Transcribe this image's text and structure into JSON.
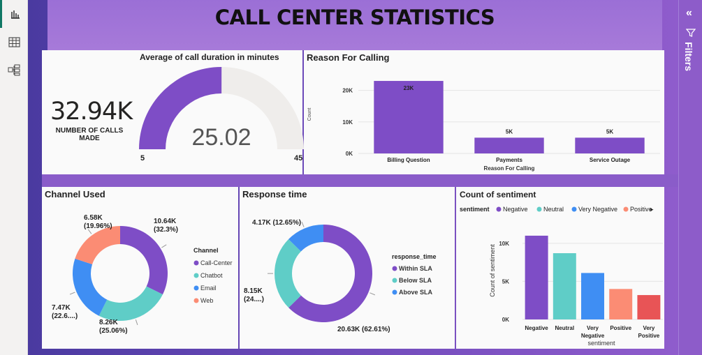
{
  "page_title": "CALL CENTER STATISTICS",
  "filters_label": "Filters",
  "kpi": {
    "value": "32.94K",
    "label_line1": "NUMBER OF CALLS",
    "label_line2": "MADE"
  },
  "gauge": {
    "title": "Average of call duration in minutes",
    "value": 25.02,
    "value_label": "25.02",
    "min": 5,
    "max": 45,
    "min_label": "5",
    "max_label": "45",
    "fill_color": "#7e4dc6",
    "track_color": "#efedeb"
  },
  "chart_data": [
    {
      "type": "bar",
      "title": "Reason For Calling",
      "xlabel": "Reason For Calling",
      "ylabel": "Count",
      "categories": [
        "Billing Question",
        "Payments",
        "Service Outage"
      ],
      "values": [
        23000,
        5000,
        5000
      ],
      "data_labels": [
        "23K",
        "5K",
        "5K"
      ],
      "ylim": [
        0,
        25000
      ],
      "yticks": [
        0,
        10000,
        20000
      ],
      "ytick_labels": [
        "0K",
        "10K",
        "20K"
      ],
      "color": "#7e4dc6"
    },
    {
      "type": "pie",
      "title": "Channel Used",
      "legend_title": "Channel",
      "categories": [
        "Call-Center",
        "Chatbot",
        "Email",
        "Web"
      ],
      "values": [
        10640,
        8260,
        7470,
        6580
      ],
      "data_labels": [
        [
          "10.64K",
          "(32.3%)"
        ],
        [
          "8.26K",
          "(25.06%)"
        ],
        [
          "7.47K",
          "(22.6....)"
        ],
        [
          "6.58K",
          "(19.96%)"
        ]
      ],
      "colors": [
        "#7e4dc6",
        "#5fcdc7",
        "#3f8ef3",
        "#fb8c74"
      ]
    },
    {
      "type": "pie",
      "title": "Response time",
      "legend_title": "response_time",
      "categories": [
        "Within SLA",
        "Below SLA",
        "Above SLA"
      ],
      "values": [
        20630,
        8150,
        4170
      ],
      "data_labels": [
        [
          "20.63K (62.61%)"
        ],
        [
          "8.15K",
          "(24....)"
        ],
        [
          "4.17K (12.65%)"
        ]
      ],
      "colors": [
        "#7e4dc6",
        "#5fcdc7",
        "#3f8ef3"
      ]
    },
    {
      "type": "bar",
      "title": "Count of sentiment",
      "legend_title": "sentiment",
      "xlabel": "sentiment",
      "ylabel": "Count of sentiment",
      "categories": [
        "Negative",
        "Neutral",
        "Very Negative",
        "Positive",
        "Very Positive"
      ],
      "category_lines": [
        [
          "Negative"
        ],
        [
          "Neutral"
        ],
        [
          "Very",
          "Negative"
        ],
        [
          "Positive"
        ],
        [
          "Very",
          "Positive"
        ]
      ],
      "values": [
        11000,
        8700,
        6100,
        4000,
        3200
      ],
      "ylim": [
        0,
        12000
      ],
      "yticks": [
        0,
        5000,
        10000
      ],
      "ytick_labels": [
        "0K",
        "5K",
        "10K"
      ],
      "colors": [
        "#7e4dc6",
        "#5fcdc7",
        "#3f8ef3",
        "#fb8c74",
        "#e85456"
      ],
      "legend_items": [
        "Negative",
        "Neutral",
        "Very Negative",
        "Positive"
      ]
    }
  ]
}
